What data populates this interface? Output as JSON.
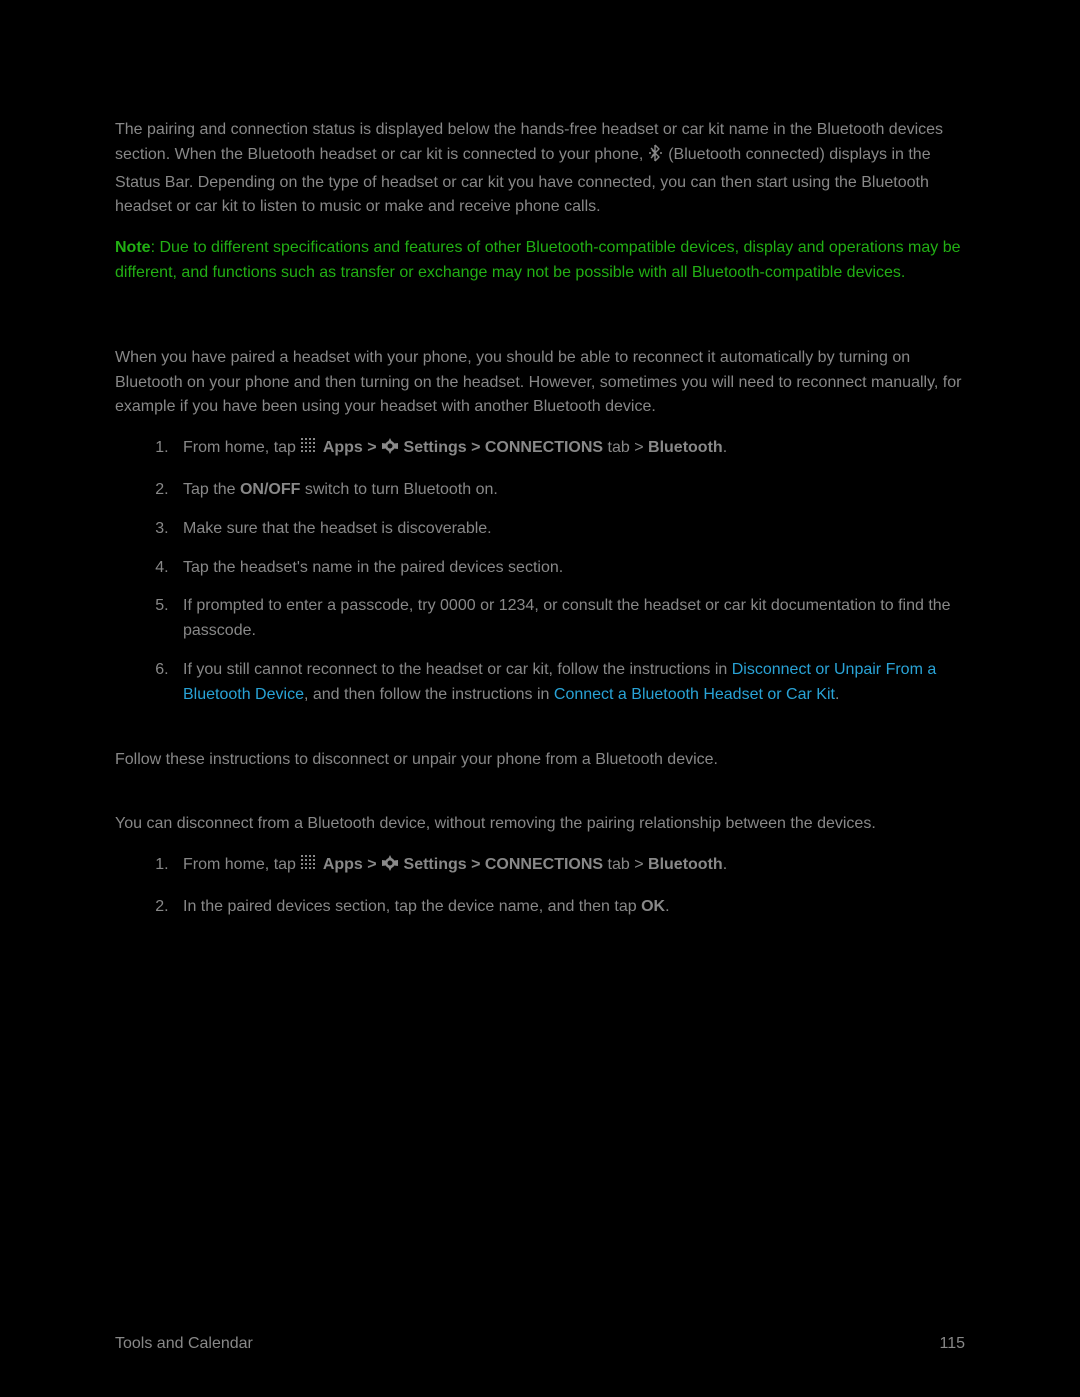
{
  "para1a": "The pairing and connection status is displayed below the hands-free headset or car kit name in the Bluetooth devices section. When the Bluetooth headset or car kit is connected to your phone, ",
  "para1b": " (Bluetooth connected) displays in the Status Bar. Depending on the type of headset or car kit you have connected, you can then start using the Bluetooth headset or car kit to listen to music or make and receive phone calls.",
  "note_label": "Note",
  "note_body": ": Due to different specifications and features of other Bluetooth-compatible devices, display and operations may be different, and functions such as transfer or exchange may not be possible with all Bluetooth-compatible devices.",
  "reconnect_intro": "When you have paired a headset with your phone, you should be able to reconnect it automatically by turning on Bluetooth on your phone and then turning on the headset. However, sometimes you will need to reconnect manually, for example if you have been using your headset with another Bluetooth device.",
  "step_home_prefix": "From home, tap ",
  "apps_label": " Apps",
  "gt": " > ",
  "settings_label": " Settings",
  "conn_tab": "CONNECTIONS",
  "tab_word": " tab > ",
  "bluetooth": "Bluetooth",
  "period": ".",
  "step2a": "Tap the ",
  "onoff": "ON/OFF",
  "step2b": " switch to turn Bluetooth on.",
  "step3": "Make sure that the headset is discoverable.",
  "step4": "Tap the headset's name in the paired devices section.",
  "step5": "If prompted to enter a passcode, try 0000 or 1234, or consult the headset or car kit documentation to find the passcode.",
  "step6a": "If you still cannot reconnect to the headset or car kit, follow the instructions in ",
  "link1": "Disconnect or Unpair From a Bluetooth Device",
  "step6b": ", and then follow the instructions in ",
  "link2": "Connect a Bluetooth Headset or Car Kit",
  "disconnect_intro": "Follow these instructions to disconnect or unpair your phone from a Bluetooth device.",
  "disconnect_sub": "You can disconnect from a Bluetooth device, without removing the pairing relationship between the devices.",
  "d_step2a": "In the paired devices section, tap the device name, and then tap ",
  "ok": "OK",
  "footer_left": "Tools and Calendar",
  "footer_right": "115"
}
